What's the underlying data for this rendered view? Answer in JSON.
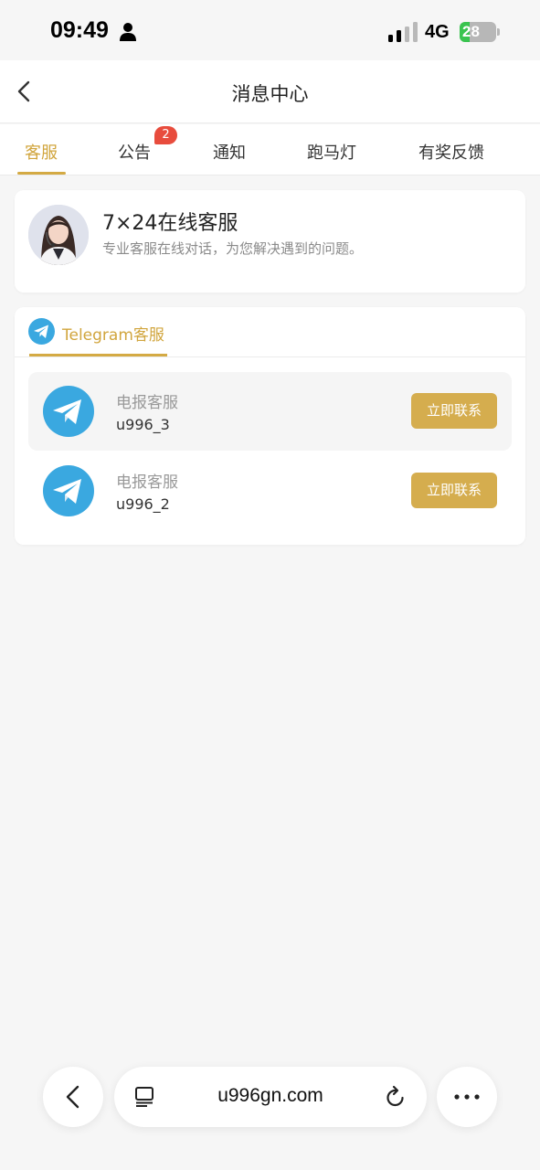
{
  "status_bar": {
    "time": "09:49",
    "network": "4G",
    "battery": "28",
    "battery_level": 0.28
  },
  "header": {
    "title": "消息中心"
  },
  "tabs": [
    {
      "label": "客服",
      "active": true
    },
    {
      "label": "公告",
      "badge": "2"
    },
    {
      "label": "通知"
    },
    {
      "label": "跑马灯"
    },
    {
      "label": "有奖反馈"
    }
  ],
  "online_service": {
    "title": "7×24在线客服",
    "description": "专业客服在线对话，为您解决遇到的问题。"
  },
  "telegram": {
    "tab_label": "Telegram客服",
    "contacts": [
      {
        "name": "电报客服",
        "id": "u996_3",
        "button": "立即联系"
      },
      {
        "name": "电报客服",
        "id": "u996_2",
        "button": "立即联系"
      }
    ]
  },
  "browser": {
    "url": "u996gn.com"
  },
  "colors": {
    "accent": "#d1a53d",
    "button": "#d5ad4e",
    "badge": "#e84c3d",
    "telegram": "#3aa8e0"
  }
}
